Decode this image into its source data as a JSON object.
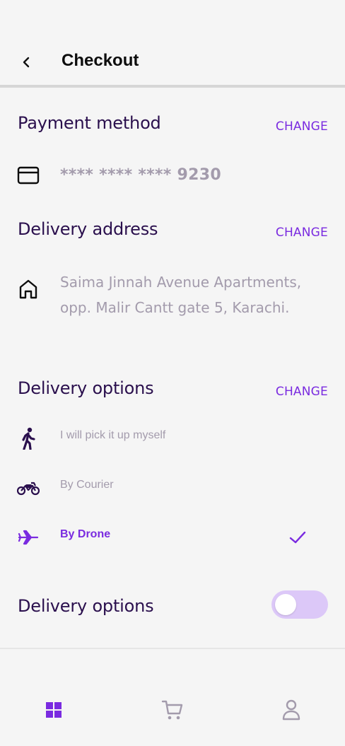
{
  "header": {
    "title": "Checkout",
    "back_icon": "chevron-left-icon"
  },
  "payment": {
    "title": "Payment method",
    "change_label": "CHANGE",
    "card_icon": "credit-card-icon",
    "card_number": "**** **** **** 9230"
  },
  "address": {
    "title": "Delivery address",
    "change_label": "CHANGE",
    "home_icon": "home-icon",
    "line1": "Saima Jinnah Avenue Apartments,",
    "line2": "opp. Malir Cantt gate 5, Karachi."
  },
  "delivery": {
    "title": "Delivery options",
    "change_label": "CHANGE",
    "options": [
      {
        "label": "I will pick it up myself",
        "icon": "walking-person-icon",
        "selected": false
      },
      {
        "label": "By Courier",
        "icon": "motorcycle-icon",
        "selected": false
      },
      {
        "label": "By Drone",
        "icon": "airplane-icon",
        "selected": true
      }
    ],
    "selected_icon": "checkmark-icon"
  },
  "toggle_section": {
    "title": "Delivery options",
    "toggle_on": false
  },
  "bottom_nav": [
    {
      "icon": "grid-icon",
      "active": true
    },
    {
      "icon": "cart-icon",
      "active": false
    },
    {
      "icon": "user-icon",
      "active": false
    }
  ],
  "colors": {
    "accent": "#7a2be0",
    "title_text": "#2a0f4d",
    "muted_text": "#a39bac",
    "toggle_track": "#dcc8f8",
    "background": "#f5f5f5"
  }
}
